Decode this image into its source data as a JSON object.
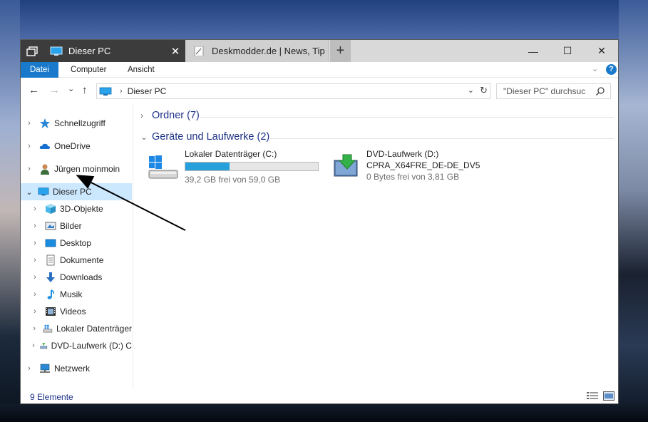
{
  "window": {
    "tabs": [
      {
        "label": "Dieser PC",
        "icon": "computer-icon",
        "active": true
      },
      {
        "label": "Deskmodder.de | News, Tip",
        "icon": "page-icon",
        "active": false
      }
    ],
    "controls": {
      "minimize": "—",
      "maximize": "☐",
      "close": "✕",
      "new_tab": "+",
      "tab_close": "✕"
    }
  },
  "ribbon": {
    "tabs": [
      "Datei",
      "Computer",
      "Ansicht"
    ],
    "help": "?"
  },
  "navigation": {
    "back": "←",
    "forward": "→",
    "recent": "⌄",
    "up": "↑",
    "breadcrumb": "Dieser PC",
    "search_placeholder": "\"Dieser PC\" durchsuc"
  },
  "sidebar": {
    "items": [
      {
        "label": "Schnellzugriff",
        "icon": "star-icon"
      },
      {
        "label": "OneDrive",
        "icon": "cloud-icon"
      },
      {
        "label": "Jürgen moinmoin",
        "icon": "user-icon"
      },
      {
        "label": "Dieser PC",
        "icon": "computer-icon",
        "selected": true,
        "expanded": true
      },
      {
        "label": "3D-Objekte",
        "icon": "cube-icon"
      },
      {
        "label": "Bilder",
        "icon": "pictures-icon"
      },
      {
        "label": "Desktop",
        "icon": "desktop-icon"
      },
      {
        "label": "Dokumente",
        "icon": "document-icon"
      },
      {
        "label": "Downloads",
        "icon": "download-icon"
      },
      {
        "label": "Musik",
        "icon": "music-icon"
      },
      {
        "label": "Videos",
        "icon": "video-icon"
      },
      {
        "label": "Lokaler Datenträger",
        "icon": "drive-icon"
      },
      {
        "label": "DVD-Laufwerk (D:) C",
        "icon": "dvd-icon"
      },
      {
        "label": "Netzwerk",
        "icon": "network-icon"
      }
    ]
  },
  "content": {
    "groups": [
      {
        "title": "Ordner (7)"
      },
      {
        "title": "Geräte und Laufwerke (2)"
      }
    ],
    "drives": [
      {
        "name": "Lokaler Datenträger (C:)",
        "free_text": "39,2 GB frei von 59,0 GB",
        "used_fraction": 0.336,
        "icon": "windows-drive-icon"
      },
      {
        "name": "DVD-Laufwerk (D:)",
        "label": "CPRA_X64FRE_DE-DE_DV5",
        "free_text": "0 Bytes frei von 3,81 GB",
        "icon": "dvd-drive-icon"
      }
    ]
  },
  "status": {
    "count": "9 Elemente"
  },
  "colors": {
    "accent": "#1979ca",
    "selection": "#cce8ff",
    "usage_bar": "#26a0da",
    "group_header": "#1e3287"
  }
}
